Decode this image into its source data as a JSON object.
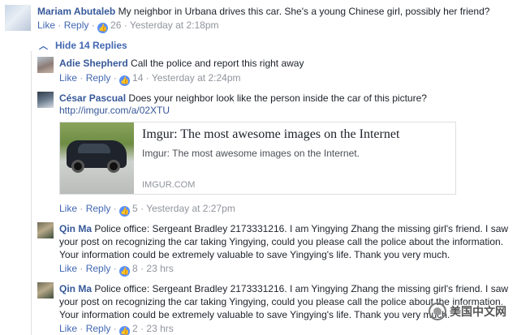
{
  "comments": [
    {
      "author": "Mariam Abutaleb",
      "lines": [
        "My neighbor in Urbana drives this car. She's a young Chinese girl, possibly her friend?"
      ],
      "like_label": "Like",
      "reply_label": "Reply",
      "likes": "26",
      "time": "Yesterday at 2:18pm",
      "avatar_icon": "profile-photo"
    }
  ],
  "hide_replies_label": "Hide 14 Replies",
  "replies": [
    {
      "author": "Adie Shepherd",
      "lines": [
        "Call the police and report this right away"
      ],
      "like_label": "Like",
      "reply_label": "Reply",
      "likes": "14",
      "time": "Yesterday at 2:24pm"
    },
    {
      "author": "César Pascual",
      "lines": [
        "Does your neighbor look like the person inside the car of this picture?"
      ],
      "url": "http://imgur.com/a/02XTU",
      "preview": {
        "title": "Imgur: The most awesome images on the Internet",
        "description": "Imgur: The most awesome images on the Internet.",
        "domain": "IMGUR.COM"
      },
      "like_label": "Like",
      "reply_label": "Reply",
      "likes": "5",
      "time": "Yesterday at 2:27pm"
    },
    {
      "author": "Qin Ma",
      "lines": [
        "Police office: Sergeant Bradley 2173331216. I am Yingying Zhang the missing girl's friend. I saw",
        "your post on recognizing the car taking Yingying, could you please call the police about the information.",
        "Your information could be extremely valuable to save Yingying's life. Thank you very much."
      ],
      "like_label": "Like",
      "reply_label": "Reply",
      "likes": "8",
      "time": "23 hrs"
    },
    {
      "author": "Qin Ma",
      "lines": [
        "Police office: Sergeant Bradley 2173331216. I am Yingying Zhang the missing girl's friend. I saw",
        "your post on recognizing the car taking Yingying, could you please call the police about the information.",
        "Your information could be extremely valuable to save Yingying's life. Thank you very much."
      ],
      "like_label": "Like",
      "reply_label": "Reply",
      "likes": "2",
      "time": "23 hrs"
    }
  ],
  "watermark": "美国中文网",
  "colors": {
    "name": "#365899",
    "link": "#4267b2",
    "meta": "#90949c",
    "like_badge": "#5890ff"
  }
}
